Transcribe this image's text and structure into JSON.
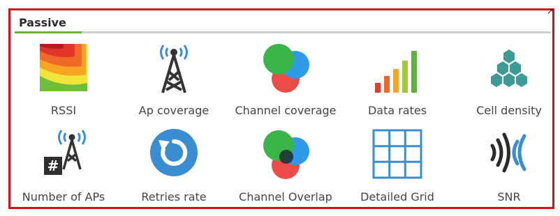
{
  "panel": {
    "title": "Passive",
    "corner_glyph": "↗",
    "accent_color": "#6fb23a",
    "border_color": "#d0121b"
  },
  "items": [
    {
      "label": "RSSI",
      "icon": "rssi-heatmap-icon"
    },
    {
      "label": "Ap coverage",
      "icon": "ap-tower-icon"
    },
    {
      "label": "Channel coverage",
      "icon": "channel-circles-icon"
    },
    {
      "label": "Data rates",
      "icon": "bar-chart-icon"
    },
    {
      "label": "Cell density",
      "icon": "hexagon-cluster-icon"
    },
    {
      "label": "Number of APs",
      "icon": "ap-count-icon"
    },
    {
      "label": "Retries rate",
      "icon": "retry-arrow-icon"
    },
    {
      "label": "Channel Overlap",
      "icon": "overlap-circles-icon"
    },
    {
      "label": "Detailed Grid",
      "icon": "grid-icon"
    },
    {
      "label": "SNR",
      "icon": "snr-waves-icon"
    }
  ]
}
